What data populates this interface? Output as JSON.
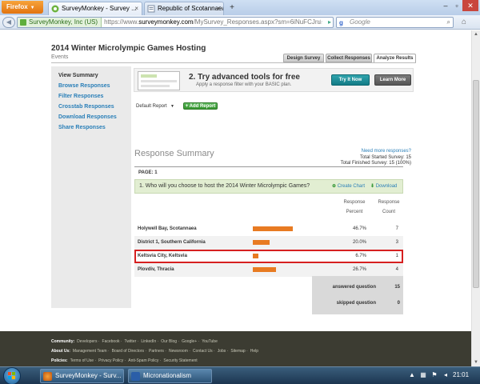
{
  "browser": {
    "menu_label": "Firefox",
    "tabs": [
      {
        "title": "SurveyMonkey - Survey ...",
        "active": true
      },
      {
        "title": "Republic of Scotannaea ...",
        "active": false
      }
    ],
    "new_tab": "+",
    "site_identity": "SurveyMonkey, Inc (US)",
    "url_scheme": "https://www.",
    "url_host": "surveymonkey.com",
    "url_path": "/MySurvey_Responses.aspx?sm=6iNuFCJru",
    "search_placeholder": "Google"
  },
  "page": {
    "title": "2014 Winter Microlympic Games Hosting",
    "subtitle": "Events",
    "top_tabs": [
      "Design Survey",
      "Collect Responses",
      "Analyze Results"
    ]
  },
  "sidebar": {
    "items": [
      "View Summary",
      "Browse Responses",
      "Filter Responses",
      "Crosstab Responses",
      "Download Responses",
      "Share Responses"
    ]
  },
  "promo": {
    "title": "2. Try advanced tools for free",
    "subtitle": "Apply a response filter with your BASIC plan.",
    "try_label": "Try It Now",
    "learn_label": "Learn More"
  },
  "report": {
    "select_value": "Default Report",
    "add_label": "+ Add Report"
  },
  "summary": {
    "title": "Response Summary",
    "need_more": "Need more responses?",
    "started": "Total Started Survey: 15",
    "finished": "Total Finished Survey: 15 (100%)",
    "page_label": "PAGE: 1",
    "question": "1. Who will you choose to host the 2014 Winter Microlympic Games?",
    "create_chart": "Create Chart",
    "download": "Download",
    "headers": {
      "percent_1": "Response",
      "percent_2": "Percent",
      "count_1": "Response",
      "count_2": "Count"
    },
    "rows": [
      {
        "label": "Holywell Bay, Scotannaea",
        "percent": "46.7%",
        "count": "7",
        "fraction": 0.467
      },
      {
        "label": "District 1, Southern California",
        "percent": "20.0%",
        "count": "3",
        "fraction": 0.2
      },
      {
        "label": "Keltsvia City, Keltsvia",
        "percent": "6.7%",
        "count": "1",
        "fraction": 0.067
      },
      {
        "label": "Plovdiv, Thracia",
        "percent": "26.7%",
        "count": "4",
        "fraction": 0.267
      }
    ],
    "answered_label": "answered question",
    "answered_value": "15",
    "skipped_label": "skipped question",
    "skipped_value": "0"
  },
  "footer": {
    "community_label": "Community:",
    "community_links": [
      "Developers",
      "Facebook",
      "Twitter",
      "LinkedIn",
      "Our Blog",
      "Google+",
      "YouTube"
    ],
    "about_label": "About Us:",
    "about_links": [
      "Management Team",
      "Board of Directors",
      "Partners",
      "Newsroom",
      "Contact Us",
      "Jobs",
      "Sitemap",
      "Help"
    ],
    "policies_label": "Policies:",
    "policies_links": [
      "Terms of Use",
      "Privacy Policy",
      "Anti-Spam Policy",
      "Security Statement"
    ]
  },
  "taskbar": {
    "tasks": [
      "SurveyMonkey - Surv...",
      "Micronationalism"
    ],
    "clock": "21:01"
  },
  "colors": {
    "bar": "#e87b22",
    "highlight": "#d62020",
    "link": "#2a7fb8"
  }
}
